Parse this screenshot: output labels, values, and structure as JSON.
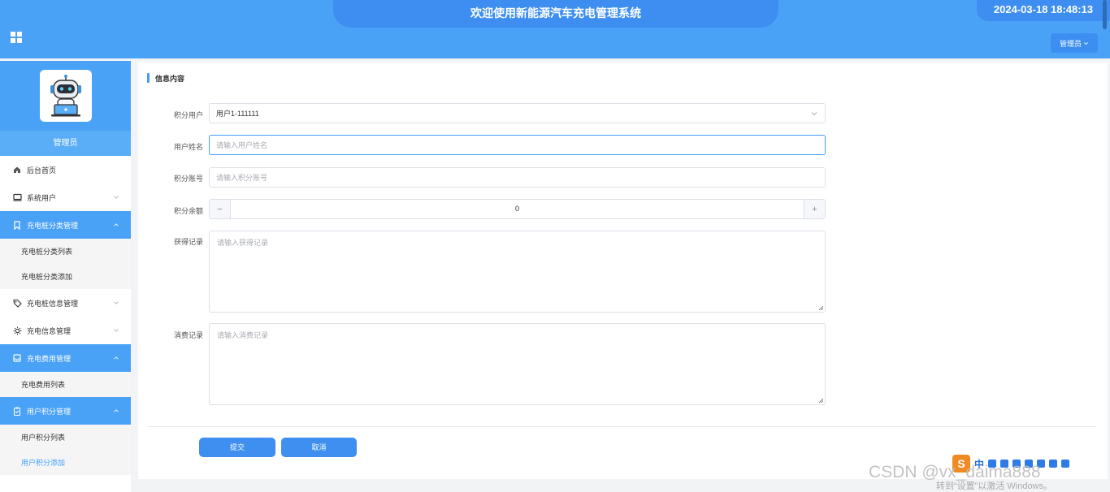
{
  "header": {
    "title": "欢迎使用新能源汽车充电管理系统",
    "datetime": "2024-03-18 18:48:13",
    "user_menu_label": "管理员",
    "menu_toggle_icon": "grid-icon"
  },
  "sidebar": {
    "role_name": "管理员",
    "avatar_icon": "robot-avatar-icon",
    "items": [
      {
        "label": "后台首页",
        "icon": "home-icon",
        "active": false
      },
      {
        "label": "系统用户",
        "icon": "monitor-icon",
        "active": false
      },
      {
        "label": "充电桩分类管理",
        "icon": "bookmark-icon",
        "active": true
      },
      {
        "label": "充电桩分类列表"
      },
      {
        "label": "充电桩分类添加"
      },
      {
        "label": "充电桩信息管理",
        "icon": "tag-icon",
        "active": false
      },
      {
        "label": "充电信息管理",
        "icon": "sun-icon",
        "active": false
      },
      {
        "label": "充电费用管理",
        "icon": "inbox-icon",
        "active": true
      },
      {
        "label": "充电费用列表"
      },
      {
        "label": "用户积分管理",
        "icon": "clipboard-icon",
        "active": true
      },
      {
        "label": "用户积分列表"
      },
      {
        "label": "用户积分添加",
        "current": true
      }
    ]
  },
  "form": {
    "section_title": "信息内容",
    "fields": {
      "points_user": {
        "label": "积分用户",
        "value": "用户1-111111"
      },
      "user_name": {
        "label": "用户姓名",
        "placeholder": "请输入用户姓名"
      },
      "points_account": {
        "label": "积分账号",
        "placeholder": "请输入积分账号"
      },
      "points_balance": {
        "label": "积分余额",
        "value": "0",
        "minus": "−",
        "plus": "+"
      },
      "earn_record": {
        "label": "获得记录",
        "placeholder": "请输入获得记录"
      },
      "spend_record": {
        "label": "消费记录",
        "placeholder": "请输入消费记录"
      }
    },
    "submit_label": "提交",
    "cancel_label": "取消"
  },
  "overlay": {
    "ime_logo": "S",
    "ime_lang": "中",
    "watermark": "CSDN @vx_daima888",
    "activate_note": "转到“设置”以激活 Windows。"
  },
  "colors": {
    "header_bg": "#4aa2f6",
    "title_pill": "#3d8ef0",
    "active_menu": "#4aa2f6",
    "primary": "#409eff"
  }
}
